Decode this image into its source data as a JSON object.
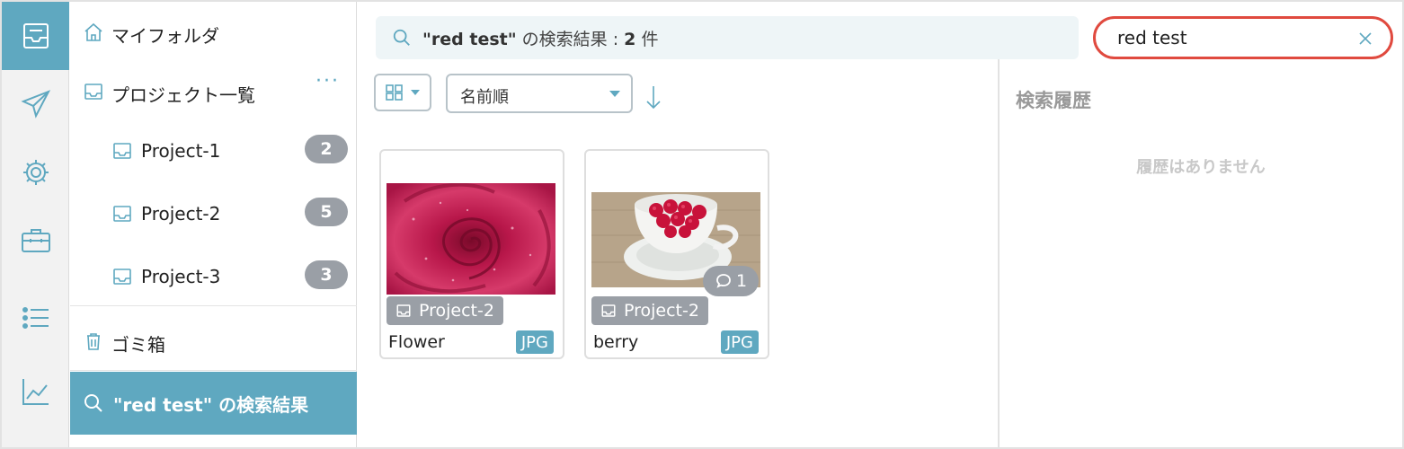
{
  "rail": {
    "items": [
      {
        "icon": "inbox-icon",
        "active": true
      },
      {
        "icon": "send-icon",
        "active": false
      },
      {
        "icon": "gear-icon",
        "active": false
      },
      {
        "icon": "briefcase-icon",
        "active": false
      },
      {
        "icon": "list-icon",
        "active": false
      },
      {
        "icon": "chart-icon",
        "active": false
      }
    ]
  },
  "sidebar": {
    "my_folder": "マイフォルダ",
    "projects_header": "プロジェクト一覧",
    "more": "···",
    "projects": [
      {
        "label": "Project-1",
        "count": "2"
      },
      {
        "label": "Project-2",
        "count": "5"
      },
      {
        "label": "Project-3",
        "count": "3"
      }
    ],
    "trash": "ゴミ箱",
    "search_result": "\"red test\" の検索結果"
  },
  "results_bar": {
    "query": "\"red test\"",
    "middle": " の検索結果 : ",
    "count": "2",
    "suffix": " 件"
  },
  "search": {
    "value": "red test"
  },
  "toolbar": {
    "sort_value": "名前順"
  },
  "assets": [
    {
      "project": "Project-2",
      "name": "Flower",
      "type": "JPG"
    },
    {
      "project": "Project-2",
      "name": "berry",
      "type": "JPG",
      "comments": "1"
    }
  ],
  "history": {
    "title": "検索履歴",
    "empty": "履歴はありません"
  },
  "colors": {
    "accent": "#5fa8c0",
    "badge_gray": "#9a9fa6",
    "search_outline": "#e04a3f"
  }
}
